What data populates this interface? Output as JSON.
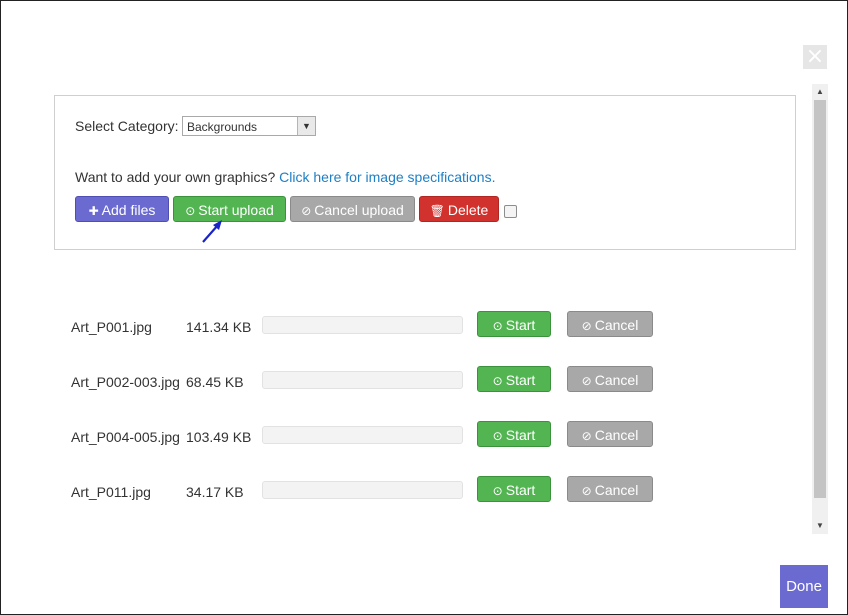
{
  "dialog": {
    "close_symbol": "×",
    "done_label": "Done"
  },
  "panel": {
    "category_label": "Select Category:",
    "category_value": "Backgrounds",
    "want_text": "Want to add your own graphics?",
    "link_text": "Click here for image specifications.",
    "buttons": {
      "add_files": "Add files",
      "start_upload": "Start upload",
      "cancel_upload": "Cancel upload",
      "delete": "Delete"
    }
  },
  "files": [
    {
      "name": "Art_P001.jpg",
      "size": "141.34 KB",
      "start": "Start",
      "cancel": "Cancel"
    },
    {
      "name": "Art_P002-003.jpg",
      "size": "68.45 KB",
      "start": "Start",
      "cancel": "Cancel"
    },
    {
      "name": "Art_P004-005.jpg",
      "size": "103.49 KB",
      "start": "Start",
      "cancel": "Cancel"
    },
    {
      "name": "Art_P011.jpg",
      "size": "34.17 KB",
      "start": "Start",
      "cancel": "Cancel"
    }
  ],
  "colors": {
    "purple": "#6a6ad1",
    "green": "#52b552",
    "gray": "#a8a8a8",
    "red": "#d2322d",
    "link": "#1e7fc4"
  }
}
